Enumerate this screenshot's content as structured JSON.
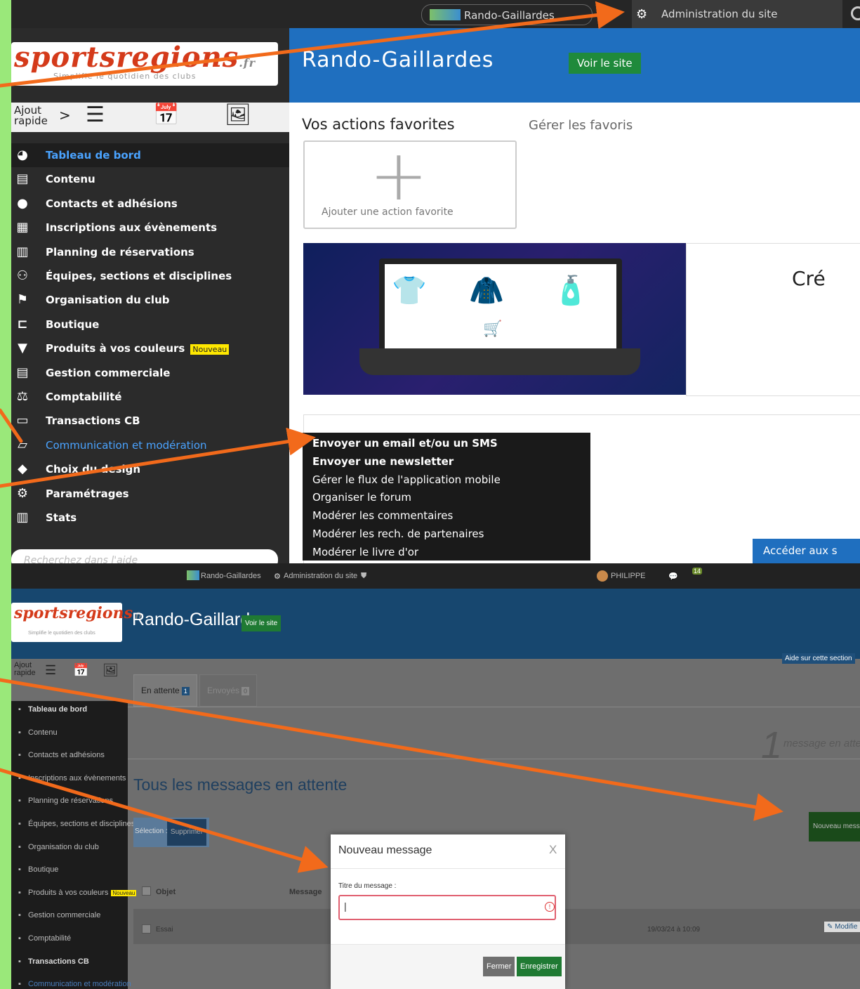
{
  "top": {
    "topbar": {
      "site": "Rando-Gaillardes",
      "admin": "Administration du site"
    },
    "logo": {
      "brand": "sportsregions",
      "tld": ".fr",
      "tagline": "Simplifie le quotidien des clubs"
    },
    "quick_add": "Ajout rapide",
    "quick_add_chevron": ">",
    "menu": [
      {
        "label": "Tableau de bord",
        "icon": "dashboard-icon"
      },
      {
        "label": "Contenu",
        "icon": "document-icon"
      },
      {
        "label": "Contacts et adhésions",
        "icon": "user-icon"
      },
      {
        "label": "Inscriptions aux évènements",
        "icon": "calendar-icon"
      },
      {
        "label": "Planning de réservations",
        "icon": "planning-icon"
      },
      {
        "label": "Équipes, sections et disciplines",
        "icon": "team-icon"
      },
      {
        "label": "Organisation du club",
        "icon": "org-icon"
      },
      {
        "label": "Boutique",
        "icon": "cart-icon"
      },
      {
        "label": "Produits à vos couleurs",
        "icon": "tshirt-icon",
        "badge": "Nouveau"
      },
      {
        "label": "Gestion commerciale",
        "icon": "invoice-icon"
      },
      {
        "label": "Comptabilité",
        "icon": "balance-icon"
      },
      {
        "label": "Transactions CB",
        "icon": "card-icon"
      },
      {
        "label": "Communication et modération",
        "icon": "chat-icon"
      },
      {
        "label": "Choix du design",
        "icon": "design-icon"
      },
      {
        "label": "Paramétrages",
        "icon": "gear-icon"
      },
      {
        "label": "Stats",
        "icon": "stats-icon"
      }
    ],
    "search_placeholder": "Recherchez dans l'aide",
    "header": {
      "title": "Rando-Gaillardes",
      "voir": "Voir le site"
    },
    "favorites": {
      "title": "Vos actions favorites",
      "manage": "Gérer les favoris",
      "add": "Ajouter une action favorite"
    },
    "promo_text": "Cré",
    "acceder": "Accéder aux s",
    "submenu": [
      "Envoyer un email et/ou un SMS",
      "Envoyer une newsletter",
      "Gérer le flux de l'application mobile",
      "Organiser le forum",
      "Modérer les commentaires",
      "Modérer les rech. de partenaires",
      "Modérer le livre d'or"
    ]
  },
  "bottom": {
    "topbar": {
      "site": "Rando-Gaillardes",
      "admin": "Administration du site",
      "user": "PHILIPPE",
      "notif": "14"
    },
    "logo": {
      "brand": "sportsregions",
      "tld": ".fr",
      "tagline": "Simplifie le quotidien des clubs"
    },
    "header": {
      "title": "Rando-Gaillardes",
      "voir": "Voir le site"
    },
    "quick_add": "Ajout rapide",
    "aide": "Aide sur cette section",
    "tabs": [
      {
        "label": "En attente",
        "count": "1"
      },
      {
        "label": "Envoyés",
        "count": "0"
      }
    ],
    "pending": {
      "count": "1",
      "label": "message en atte"
    },
    "page_title": "Tous les messages en attente",
    "selection": {
      "label": "Sélection :",
      "delete": "Supprimer"
    },
    "new_message": "Nouveau messa",
    "table": {
      "headers": [
        "Objet",
        "Message"
      ],
      "rows": [
        {
          "objet": "Essai",
          "date": "19/03/24 à 10:09",
          "action": "Modifie"
        }
      ]
    },
    "menu": [
      {
        "label": "Tableau de bord"
      },
      {
        "label": "Contenu"
      },
      {
        "label": "Contacts et adhésions"
      },
      {
        "label": "Inscriptions aux évènements"
      },
      {
        "label": "Planning de réservations"
      },
      {
        "label": "Équipes, sections et disciplines"
      },
      {
        "label": "Organisation du club"
      },
      {
        "label": "Boutique"
      },
      {
        "label": "Produits à vos couleurs",
        "badge": "Nouveau"
      },
      {
        "label": "Gestion commerciale"
      },
      {
        "label": "Comptabilité"
      },
      {
        "label": "Transactions CB"
      },
      {
        "label": "Communication et modération"
      }
    ],
    "modal": {
      "title": "Nouveau message",
      "close": "X",
      "field_label": "Titre du message :",
      "fermer": "Fermer",
      "enregistrer": "Enregistrer"
    }
  },
  "colors": {
    "frame": "#9ae87a",
    "header_blue": "#1f6fbf",
    "arrow": "#f26a1b",
    "brand_red": "#d43a1a",
    "green": "#1f8a3b"
  }
}
